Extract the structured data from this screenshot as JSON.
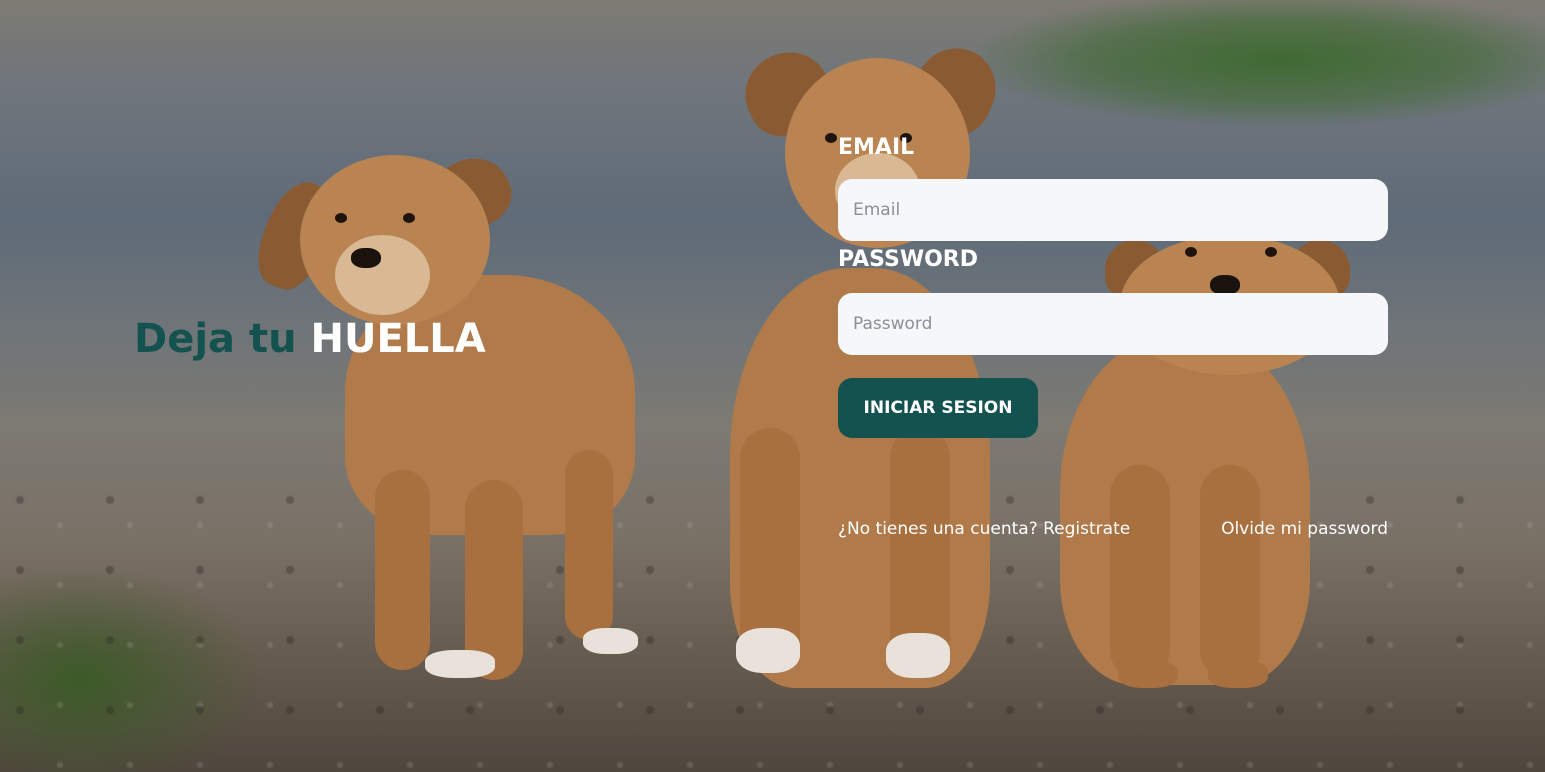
{
  "hero": {
    "tagline_part1": "Deja tu",
    "tagline_part2": "HUELLA",
    "accent_color": "#14524f",
    "background_image": "three puppies sitting on gravel ground"
  },
  "login_form": {
    "email_label": "EMAIL",
    "email_placeholder": "Email",
    "email_value": "",
    "password_label": "PASSWORD",
    "password_placeholder": "Password",
    "password_value": "",
    "submit_label": "INICIAR SESION"
  },
  "links": {
    "register": "¿No tienes una cuenta? Registrate",
    "forgot_password": "Olvide mi password"
  }
}
